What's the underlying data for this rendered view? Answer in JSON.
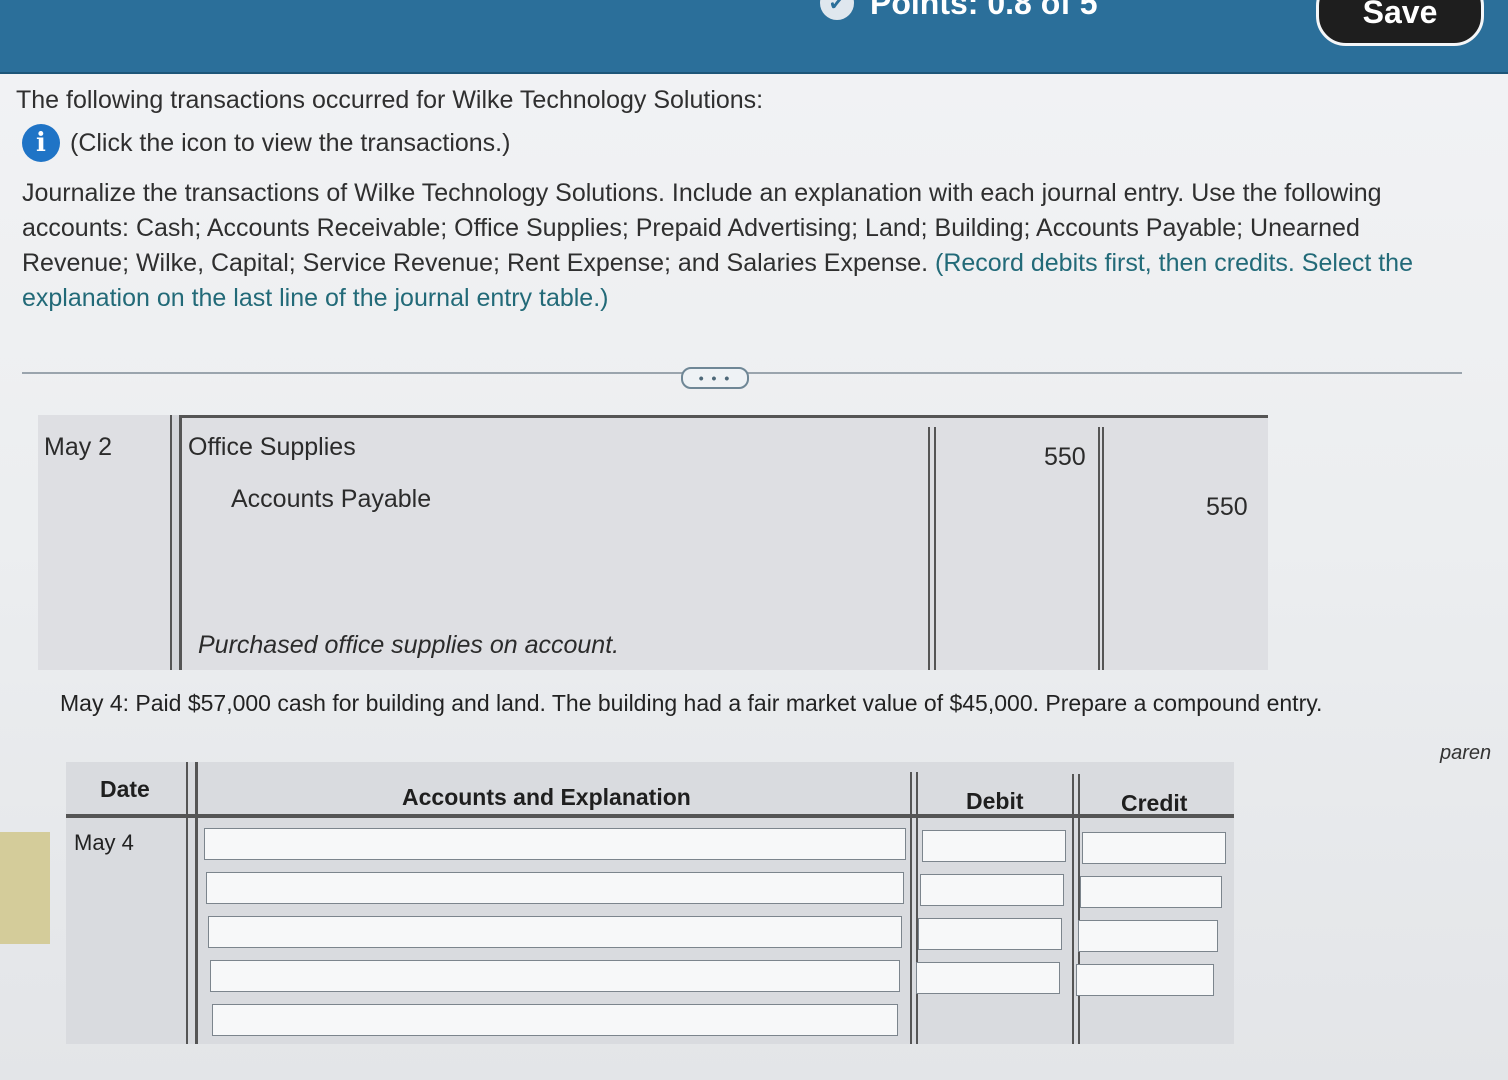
{
  "header": {
    "points_label": "Points: 0.8 of 5",
    "save_label": "Save"
  },
  "question": {
    "intro": "The following transactions occurred for Wilke Technology Solutions:",
    "info_link": "(Click the icon to view the transactions.)",
    "instructions_main": "Journalize the transactions of Wilke Technology Solutions. Include an explanation with each journal entry. Use the following accounts: Cash; Accounts Receivable; Office Supplies; Prepaid Advertising; Land; Building; Accounts Payable; Unearned Revenue; Wilke, Capital; Service Revenue; Rent Expense; and Salaries Expense.",
    "instructions_note": "(Record debits first, then credits. Select the explanation on the last line of the journal entry table.)",
    "more_label": "• • •"
  },
  "entry_may2": {
    "date": "May 2",
    "debit_account": "Office Supplies",
    "credit_account": "Accounts Payable",
    "debit_amount": "550",
    "credit_amount": "550",
    "explanation": "Purchased office supplies on account."
  },
  "prompt_may4": "May 4: Paid $57,000 cash for building and land. The building had a fair market value of $45,000. Prepare a compound entry.",
  "side_text": "paren",
  "journal_table": {
    "headers": {
      "date": "Date",
      "accounts": "Accounts and Explanation",
      "debit": "Debit",
      "credit": "Credit"
    },
    "date": "May 4"
  }
}
